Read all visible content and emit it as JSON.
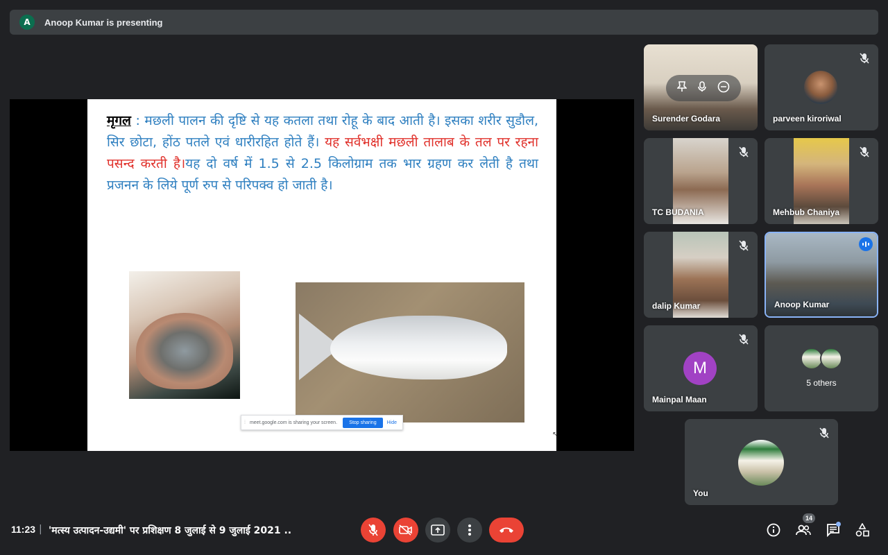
{
  "banner": {
    "avatar_letter": "A",
    "text": "Anoop Kumar is presenting"
  },
  "slide": {
    "term": "मृगल",
    "text_blue_1": " : मछली पालन की दृष्टि से यह कतला तथा रोहू के बाद आती है। इसका शरीर सुडौल, सिर छोटा, होंठ पतले एवं धारीरहित होते हैं। ",
    "text_red": "यह सर्वभक्षी मछली तालाब के तल पर रहना पसन्द करती है।",
    "text_blue_2": "यह दो वर्ष में 1.5 से 2.5 किलोग्राम तक भार ग्रहण कर लेती है तथा प्रजनन के लिये पूर्ण रुप से परिपक्व हो जाती है।"
  },
  "share_bar": {
    "message": "meet.google.com is sharing your screen.",
    "stop_label": "Stop sharing",
    "hide_label": "Hide"
  },
  "participants": [
    {
      "name": "Surender Godara",
      "muted": false
    },
    {
      "name": "parveen kiroriwal",
      "muted": true
    },
    {
      "name": "TC BUDANIA",
      "muted": true
    },
    {
      "name": "Mehbub Chaniya",
      "muted": true
    },
    {
      "name": "dalip Kumar",
      "muted": true
    },
    {
      "name": "Anoop Kumar",
      "muted": false,
      "speaking": true
    },
    {
      "name": "Mainpal Maan",
      "muted": true,
      "initial": "M"
    },
    {
      "name": "5 others"
    },
    {
      "name": "You",
      "muted": true
    }
  ],
  "bottom": {
    "time": "11:23",
    "separator": "|",
    "meeting_title": "'मत्स्य उत्पादन-उद्यमी' पर प्रशिक्षण 8 जुलाई से 9 जुलाई 2021 ...",
    "people_count": "14"
  },
  "colors": {
    "end_call": "#ea4335",
    "speaking_border": "#8ab4f8",
    "mainpal_avatar": "#a142c4"
  }
}
